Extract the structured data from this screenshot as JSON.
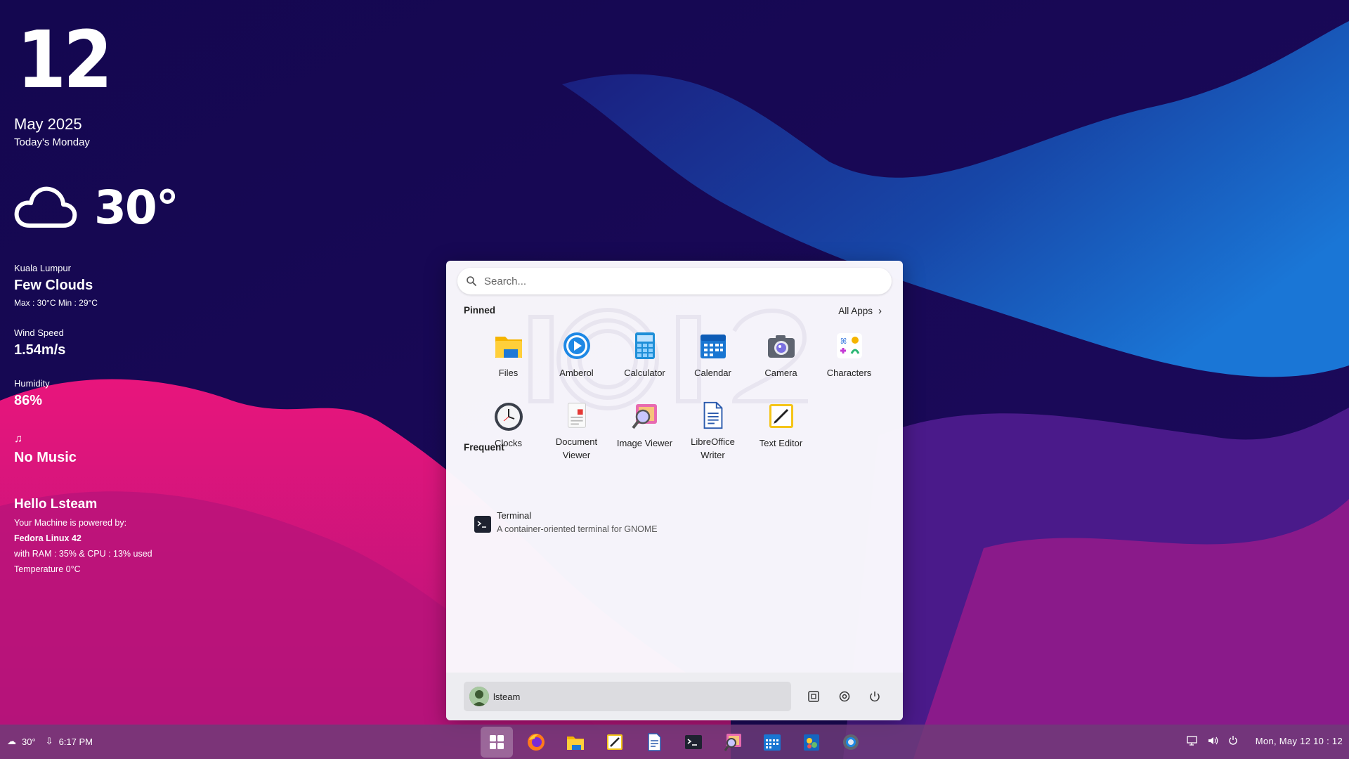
{
  "desktop_widget": {
    "day": "12",
    "month_year": "May 2025",
    "weekday": "Today's Monday",
    "weather_icon": "cloud-icon",
    "temperature": "30°",
    "city": "Kuala Lumpur",
    "condition": "Few Clouds",
    "minmax": "Max : 30°C   Min : 29°C",
    "wind_label": "Wind Speed",
    "wind_value": "1.54m/s",
    "humidity_label": "Humidity",
    "humidity_value": "86%",
    "music_icon": "music-note-icon",
    "music": "No Music",
    "greeting": "Hello Lsteam",
    "powered_by": "Your Machine is powered by:",
    "os": "Fedora Linux 42",
    "usage": "with RAM : 35% & CPU : 13% used",
    "temperature_info": "Temperature 0°C"
  },
  "start_menu": {
    "search_placeholder": "Search...",
    "pinned_title": "Pinned",
    "all_apps_label": "All Apps",
    "pinned_apps": [
      {
        "label": "Files",
        "icon": "files-icon"
      },
      {
        "label": "Amberol",
        "icon": "amberol-icon"
      },
      {
        "label": "Calculator",
        "icon": "calculator-icon"
      },
      {
        "label": "Calendar",
        "icon": "calendar-icon"
      },
      {
        "label": "Camera",
        "icon": "camera-icon"
      },
      {
        "label": "Characters",
        "icon": "characters-icon"
      },
      {
        "label": "Clocks",
        "icon": "clocks-icon"
      },
      {
        "label": "Document Viewer",
        "icon": "document-viewer-icon"
      },
      {
        "label": "Image Viewer",
        "icon": "image-viewer-icon"
      },
      {
        "label": "LibreOffice Writer",
        "icon": "libreoffice-writer-icon"
      },
      {
        "label": "Text Editor",
        "icon": "text-editor-icon"
      }
    ],
    "frequent_title": "Frequent",
    "frequent": [
      {
        "name": "Terminal",
        "description": "A container-oriented terminal for GNOME",
        "icon": "terminal-icon"
      }
    ],
    "user_name": "lsteam",
    "footer_buttons": [
      "screenshot-icon",
      "settings-icon",
      "power-icon"
    ]
  },
  "taskbar": {
    "weather_temp": "30°",
    "sunset_time": "6:17 PM",
    "pinned": [
      "start-button",
      "firefox-icon",
      "files-icon",
      "text-editor-icon",
      "writer-icon",
      "terminal-icon",
      "image-viewer-icon",
      "calendar-icon",
      "extension-manager-icon",
      "settings-icon"
    ],
    "tray": [
      "network-icon",
      "volume-icon",
      "power-icon"
    ],
    "clock": "Mon, May 12  10 : 12"
  },
  "colors": {
    "background_dark": "#12074a",
    "pink_wave": "#e0157a",
    "blue_wave": "#1a6fd0",
    "menu_bg": "#faf8fd",
    "taskbar": "#6e3c78"
  }
}
